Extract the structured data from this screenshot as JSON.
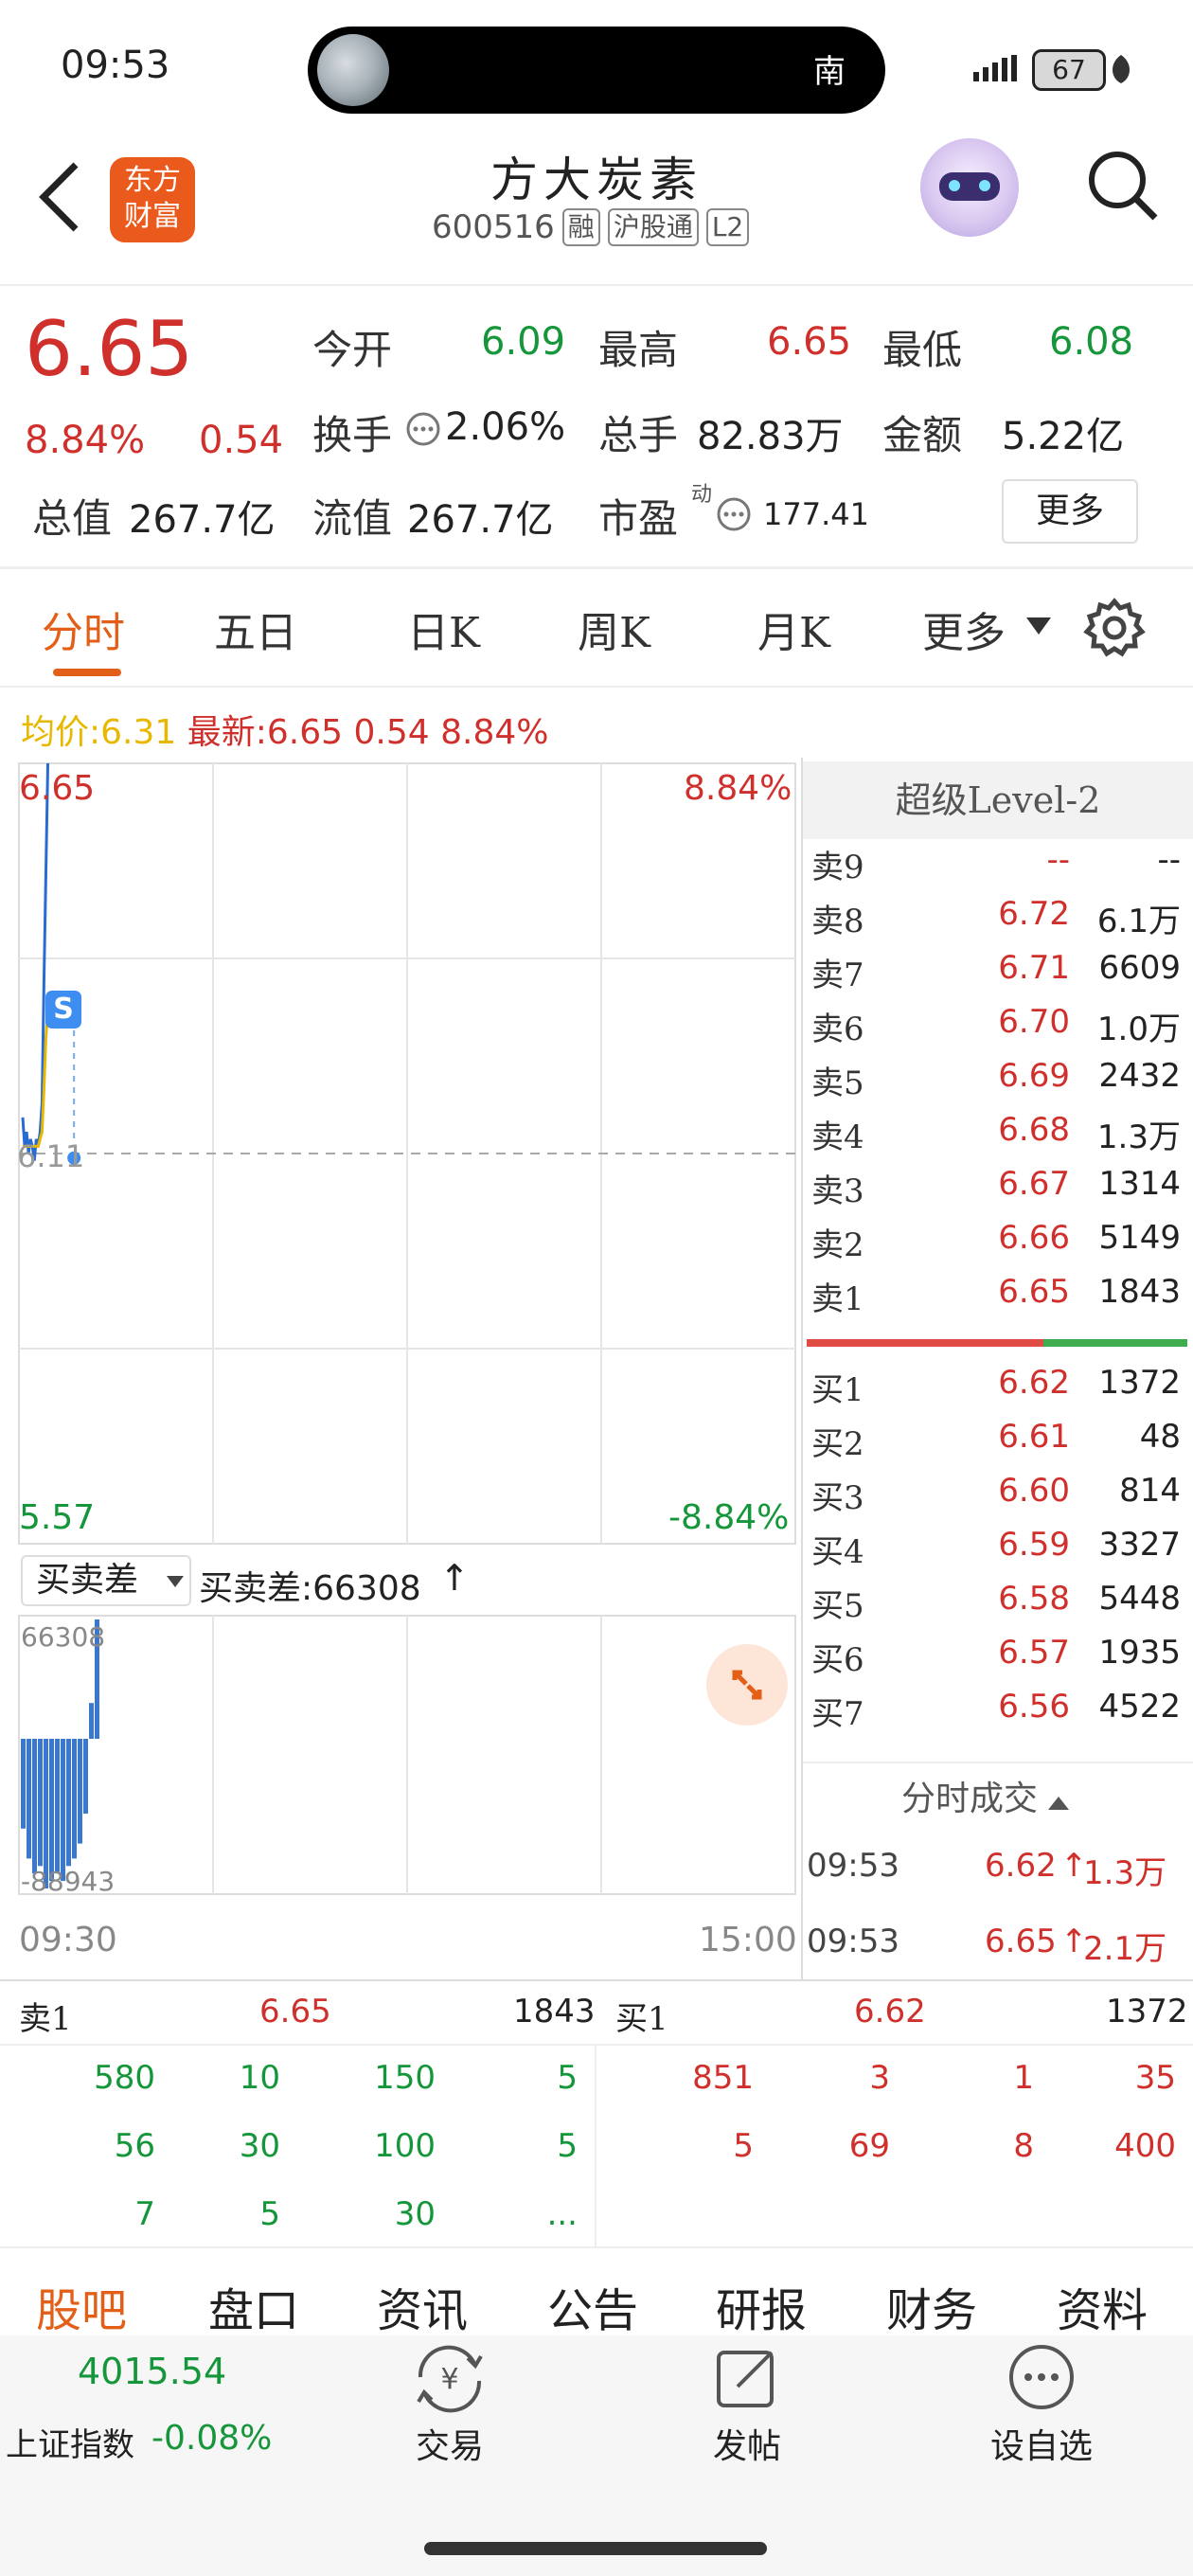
{
  "status_bar": {
    "time": "09:53",
    "pill_text": "南",
    "battery": "67"
  },
  "header": {
    "title": "方大炭素",
    "code": "600516",
    "tags": [
      "融",
      "沪股通",
      "L2"
    ],
    "logo_line1": "东方",
    "logo_line2": "财富"
  },
  "quote": {
    "price": "6.65",
    "change_pct": "8.84%",
    "change": "0.54",
    "open_label": "今开",
    "open": "6.09",
    "high_label": "最高",
    "high": "6.65",
    "low_label": "最低",
    "low": "6.08",
    "turnover_label": "换手",
    "turnover": "2.06%",
    "volume_label": "总手",
    "volume": "82.83万",
    "amount_label": "金额",
    "amount": "5.22亿",
    "mcap_label": "总值",
    "mcap": "267.7亿",
    "float_label": "流值",
    "float": "267.7亿",
    "pe_label": "市盈",
    "pe_sup": "动",
    "pe": "177.41",
    "more_button": "更多"
  },
  "tabs": [
    "分时",
    "五日",
    "日K",
    "周K",
    "月K",
    "更多"
  ],
  "chart_info": {
    "avg_label": "均价:",
    "avg": "6.31",
    "latest_label": "最新:",
    "latest": "6.65 0.54 8.84%"
  },
  "chart_data": {
    "type": "line",
    "y_ticks_left": [
      "6.65",
      "6.11",
      "5.57"
    ],
    "y_ticks_right": [
      "8.84%",
      "-8.84%"
    ],
    "x_ticks": [
      "09:30",
      "15:00"
    ],
    "ylim": [
      5.57,
      6.65
    ],
    "series": [
      {
        "values": [
          6.16,
          6.12,
          6.14,
          6.11,
          6.13,
          6.12,
          6.1,
          6.13,
          6.12,
          6.14,
          6.18,
          6.35,
          6.5,
          6.65
        ],
        "color": "#2a6bd1"
      },
      {
        "values": [
          6.12,
          6.12,
          6.12,
          6.12,
          6.12,
          6.12,
          6.12,
          6.12,
          6.12,
          6.13,
          6.14,
          6.2,
          6.27,
          6.31
        ],
        "color": "#e8b800"
      }
    ],
    "marker_label": "S"
  },
  "sub_chart": {
    "selector": "买卖差",
    "label": "买卖差:66308",
    "top": "66308",
    "bottom": "-88943",
    "bars": [
      -0.6,
      -0.8,
      -0.9,
      -0.85,
      -1.0,
      -0.95,
      -0.9,
      -0.95,
      -0.85,
      -0.8,
      -0.7,
      -0.5,
      0.3,
      1.0
    ]
  },
  "level2": {
    "title": "超级Level-2",
    "asks": [
      {
        "label": "卖9",
        "price": "--",
        "vol": "--"
      },
      {
        "label": "卖8",
        "price": "6.72",
        "vol": "6.1万"
      },
      {
        "label": "卖7",
        "price": "6.71",
        "vol": "6609"
      },
      {
        "label": "卖6",
        "price": "6.70",
        "vol": "1.0万"
      },
      {
        "label": "卖5",
        "price": "6.69",
        "vol": "2432"
      },
      {
        "label": "卖4",
        "price": "6.68",
        "vol": "1.3万"
      },
      {
        "label": "卖3",
        "price": "6.67",
        "vol": "1314"
      },
      {
        "label": "卖2",
        "price": "6.66",
        "vol": "5149"
      },
      {
        "label": "卖1",
        "price": "6.65",
        "vol": "1843"
      }
    ],
    "bids": [
      {
        "label": "买1",
        "price": "6.62",
        "vol": "1372"
      },
      {
        "label": "买2",
        "price": "6.61",
        "vol": "48"
      },
      {
        "label": "买3",
        "price": "6.60",
        "vol": "814"
      },
      {
        "label": "买4",
        "price": "6.59",
        "vol": "3327"
      },
      {
        "label": "买5",
        "price": "6.58",
        "vol": "5448"
      },
      {
        "label": "买6",
        "price": "6.57",
        "vol": "1935"
      },
      {
        "label": "买7",
        "price": "6.56",
        "vol": "4522"
      }
    ],
    "ticks_title": "分时成交",
    "ticks": [
      {
        "time": "09:53",
        "price": "6.62",
        "vol": "1.3万"
      },
      {
        "time": "09:53",
        "price": "6.65",
        "vol": "2.1万"
      }
    ]
  },
  "queue": {
    "sell_label": "卖1",
    "sell_price": "6.65",
    "sell_total": "1843",
    "buy_label": "买1",
    "buy_price": "6.62",
    "buy_total": "1372",
    "sell_rows": [
      [
        "580",
        "10",
        "150",
        "5"
      ],
      [
        "56",
        "30",
        "100",
        "5"
      ],
      [
        "7",
        "5",
        "30",
        "..."
      ]
    ],
    "buy_rows": [
      [
        "851",
        "3",
        "1",
        "35"
      ],
      [
        "5",
        "69",
        "8",
        "400"
      ]
    ]
  },
  "bottom_tabs": [
    "股吧",
    "盘口",
    "资讯",
    "公告",
    "研报",
    "财务",
    "资料"
  ],
  "footer": {
    "index_value": "4015.54",
    "index_name": "上证指数",
    "index_change": "-0.08%",
    "trade": "交易",
    "post": "发帖",
    "watch": "设自选"
  }
}
